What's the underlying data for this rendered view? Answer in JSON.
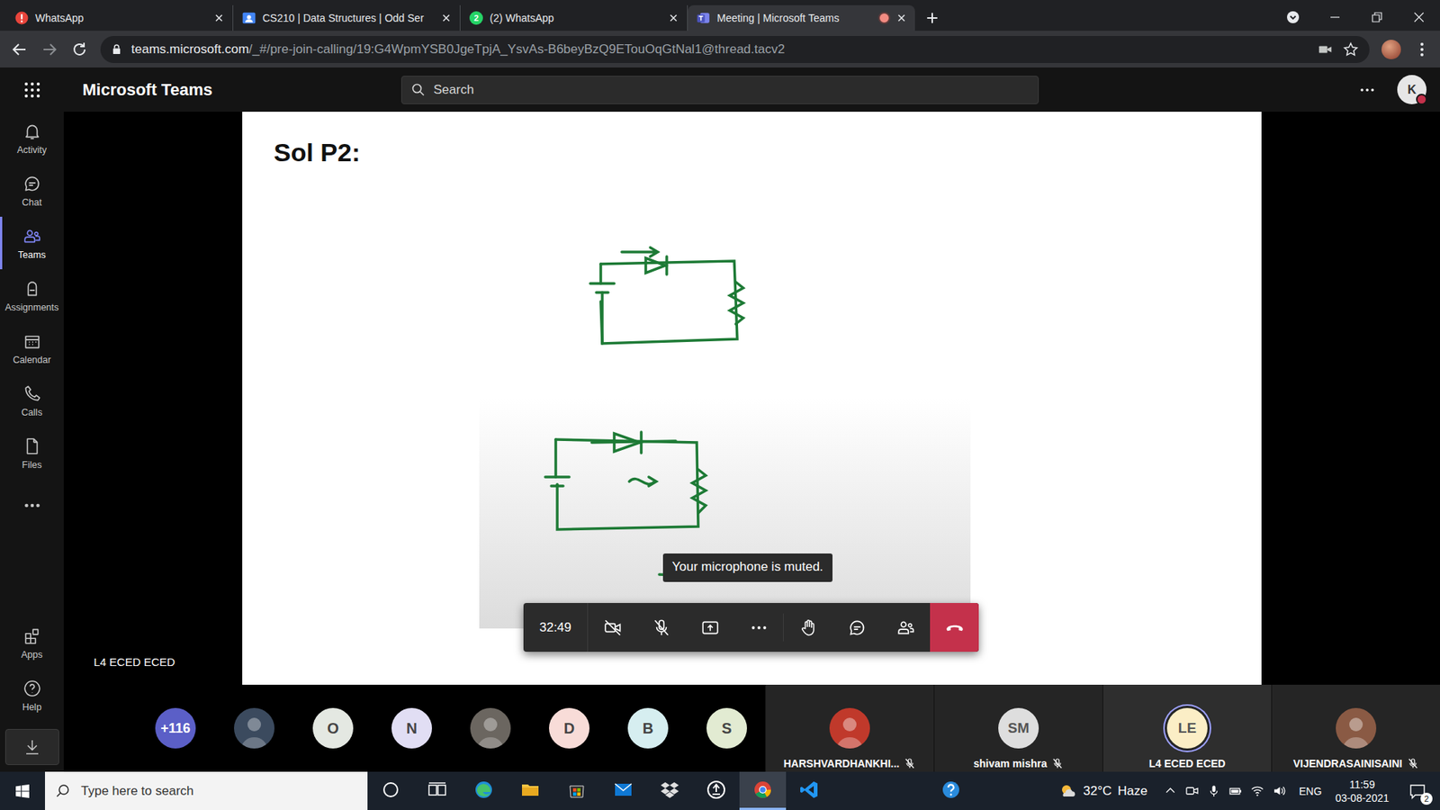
{
  "browser": {
    "tabs": [
      {
        "label": "WhatsApp",
        "selected": false,
        "kind": "alert",
        "badge": "",
        "recording": false
      },
      {
        "label": "CS210 | Data Structures | Odd Ser",
        "selected": false,
        "kind": "classroom",
        "badge": "",
        "recording": false
      },
      {
        "label": "(2) WhatsApp",
        "selected": false,
        "kind": "whatsapp",
        "badge": "2",
        "recording": false
      },
      {
        "label": "Meeting | Microsoft Teams",
        "selected": true,
        "kind": "teams",
        "badge": "",
        "recording": true
      }
    ],
    "url_host": "teams.microsoft.com",
    "url_path": "/_#/pre-join-calling/19:G4WpmYSB0JgeTpjA_YsvAs-B6beyBzQ9ETouOqGtNal1@thread.tacv2"
  },
  "teams": {
    "title": "Microsoft Teams",
    "search_placeholder": "Search",
    "account": "K",
    "presence": "busy"
  },
  "rail": {
    "items": [
      {
        "label": "Activity",
        "selected": false
      },
      {
        "label": "Chat",
        "selected": false
      },
      {
        "label": "Teams",
        "selected": true
      },
      {
        "label": "Assignments",
        "selected": false
      },
      {
        "label": "Calendar",
        "selected": false
      },
      {
        "label": "Calls",
        "selected": false
      },
      {
        "label": "Files",
        "selected": false
      }
    ],
    "bottom": [
      {
        "label": "Apps",
        "selected": false
      },
      {
        "label": "Help",
        "selected": false
      }
    ]
  },
  "stage": {
    "slide_title": "Sol P2:",
    "presenter": "L4 ECED ECED",
    "toast": "Your microphone is muted.",
    "controls": {
      "timer": "32:49",
      "camera_on": false,
      "mic_on": false
    }
  },
  "gallery": {
    "overflow": "+116",
    "avatars": [
      {
        "kind": "photo",
        "initial": "",
        "color": "#3b4a5e"
      },
      {
        "kind": "initial",
        "initial": "O",
        "color": "#e4e8e2"
      },
      {
        "kind": "initial",
        "initial": "N",
        "color": "#e1def4"
      },
      {
        "kind": "photo",
        "initial": "",
        "color": "#6b6660"
      },
      {
        "kind": "initial",
        "initial": "D",
        "color": "#f8dcd8"
      },
      {
        "kind": "initial",
        "initial": "B",
        "color": "#d6eef0"
      },
      {
        "kind": "initial",
        "initial": "S",
        "color": "#e2ebd2"
      }
    ],
    "tiles": [
      {
        "name": "HARSHVARDHANKHI...",
        "kind": "photo",
        "initials": "",
        "color": "#c0392b",
        "muted": true,
        "speaking": false
      },
      {
        "name": "shivam mishra",
        "kind": "initial",
        "initials": "SM",
        "color": "#dedede",
        "muted": true,
        "speaking": false
      },
      {
        "name": "L4 ECED ECED",
        "kind": "initial",
        "initials": "LE",
        "color": "#fbeec6",
        "muted": false,
        "speaking": true
      },
      {
        "name": "VIJENDRASAINISAINI",
        "kind": "photo",
        "initials": "",
        "color": "#8a5a44",
        "muted": true,
        "speaking": false
      }
    ]
  },
  "taskbar": {
    "search_placeholder": "Type here to search",
    "apps": [
      {
        "selected": false
      },
      {
        "selected": false
      },
      {
        "selected": false
      },
      {
        "selected": false
      },
      {
        "selected": false
      },
      {
        "selected": false
      },
      {
        "selected": false
      },
      {
        "selected": false
      },
      {
        "selected": true
      },
      {
        "selected": false
      }
    ],
    "temperature": "32°C",
    "condition": "Haze",
    "language": "ENG",
    "time": "11:59",
    "date": "03-08-2021",
    "notifications": "2"
  }
}
